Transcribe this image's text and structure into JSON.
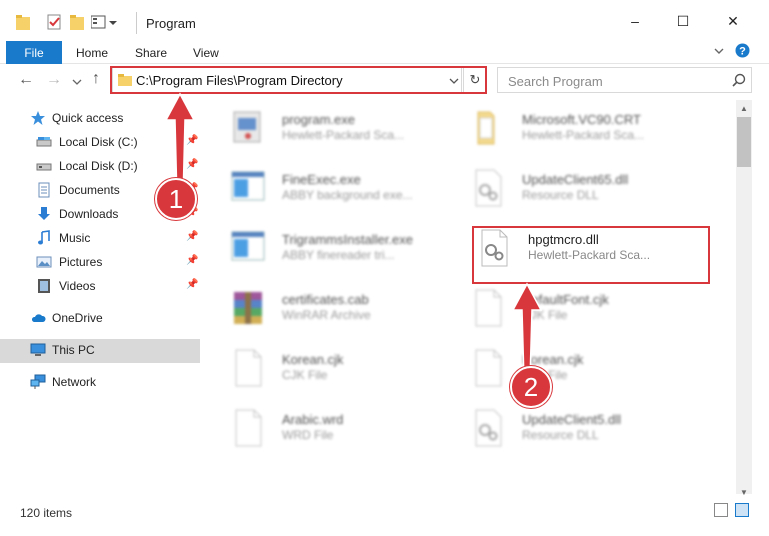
{
  "window": {
    "title": "Program",
    "controls": {
      "minimize": "–",
      "maximize": "☐",
      "close": "✕"
    }
  },
  "ribbon": {
    "tabs": [
      "File",
      "Home",
      "Share",
      "View"
    ]
  },
  "address": {
    "path": "C:\\Program Files\\Program Directory",
    "search_placeholder": "Search Program"
  },
  "sidebar": {
    "quick_access": "Quick access",
    "items": [
      {
        "label": "Local Disk (C:)",
        "icon": "drive-icon"
      },
      {
        "label": "Local Disk (D:)",
        "icon": "drive-icon"
      },
      {
        "label": "Documents",
        "icon": "documents-icon"
      },
      {
        "label": "Downloads",
        "icon": "downloads-icon"
      },
      {
        "label": "Music",
        "icon": "music-icon"
      },
      {
        "label": "Pictures",
        "icon": "pictures-icon"
      },
      {
        "label": "Videos",
        "icon": "videos-icon"
      }
    ],
    "onedrive": "OneDrive",
    "this_pc": "This PC",
    "network": "Network"
  },
  "files": [
    {
      "name": "program.exe",
      "desc": "Hewlett-Packard Sca..."
    },
    {
      "name": "Microsoft.VC90.CRT",
      "desc": "Hewlett-Packard Sca..."
    },
    {
      "name": "FineExec.exe",
      "desc": "ABBY background exe..."
    },
    {
      "name": "UpdateClient65.dll",
      "desc": "Resource DLL"
    },
    {
      "name": "TrigrammsInstaller.exe",
      "desc": "ABBY finereader tri..."
    },
    {
      "name": "hpgtmcro.dll",
      "desc": "Hewlett-Packard Sca..."
    },
    {
      "name": "certificates.cab",
      "desc": "WinRAR Archive"
    },
    {
      "name": "DefaultFont.cjk",
      "desc": "CJK File"
    },
    {
      "name": "Korean.cjk",
      "desc": "CJK File"
    },
    {
      "name": "Korean.cjk",
      "desc": "CJK File"
    },
    {
      "name": "Arabic.wrd",
      "desc": "WRD File"
    },
    {
      "name": "UpdateClient5.dll",
      "desc": "Resource DLL"
    }
  ],
  "status": {
    "item_count": "120 items"
  },
  "annotations": {
    "step1": "1",
    "step2": "2"
  },
  "colors": {
    "accent": "#1979ca",
    "highlight": "#d8383c"
  }
}
